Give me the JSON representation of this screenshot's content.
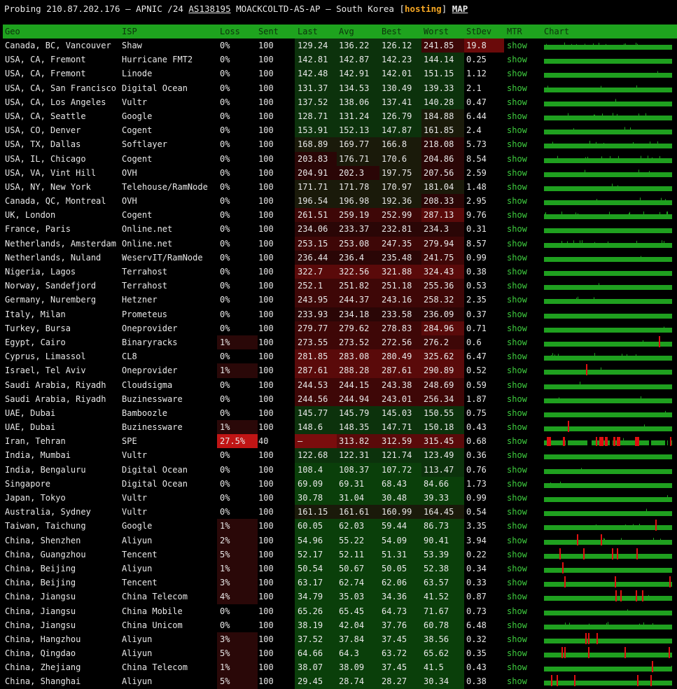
{
  "header": {
    "prefix": "Probing 210.87.202.176 – APNIC /24",
    "asn": "AS138195",
    "org": "MOACKCOLTD-AS-AP – South Korea",
    "bracket_open": "[",
    "tag": "hosting",
    "bracket_close": "]",
    "map_link": "MAP"
  },
  "columns": [
    "Geo",
    "ISP",
    "Loss",
    "Sent",
    "Last",
    "Avg",
    "Best",
    "Worst",
    "StDev",
    "MTR",
    "Chart"
  ],
  "mtr_label": "show",
  "colors": {
    "header_green": "#1ea31e",
    "good_green": "#0c4a0c",
    "bad_red": "#8a1010",
    "link_green": "#3fce3f",
    "accent_orange": "#f5a623"
  },
  "rows": [
    {
      "geo": "Canada, BC, Vancouver",
      "isp": "Shaw",
      "loss": "0%",
      "sent": "100",
      "last": "129.24",
      "avg": "136.22",
      "best": "126.12",
      "worst": "241.85",
      "stdev": "19.8"
    },
    {
      "geo": "USA, CA, Fremont",
      "isp": "Hurricane FMT2",
      "loss": "0%",
      "sent": "100",
      "last": "142.81",
      "avg": "142.87",
      "best": "142.23",
      "worst": "144.14",
      "stdev": "0.25"
    },
    {
      "geo": "USA, CA, Fremont",
      "isp": "Linode",
      "loss": "0%",
      "sent": "100",
      "last": "142.48",
      "avg": "142.91",
      "best": "142.01",
      "worst": "151.15",
      "stdev": "1.12"
    },
    {
      "geo": "USA, CA, San Francisco",
      "isp": "Digital Ocean",
      "loss": "0%",
      "sent": "100",
      "last": "131.37",
      "avg": "134.53",
      "best": "130.49",
      "worst": "139.33",
      "stdev": "2.1"
    },
    {
      "geo": "USA, CA, Los Angeles",
      "isp": "Vultr",
      "loss": "0%",
      "sent": "100",
      "last": "137.52",
      "avg": "138.06",
      "best": "137.41",
      "worst": "140.28",
      "stdev": "0.47"
    },
    {
      "geo": "USA, CA, Seattle",
      "isp": "Google",
      "loss": "0%",
      "sent": "100",
      "last": "128.71",
      "avg": "131.24",
      "best": "126.79",
      "worst": "184.88",
      "stdev": "6.44"
    },
    {
      "geo": "USA, CO, Denver",
      "isp": "Cogent",
      "loss": "0%",
      "sent": "100",
      "last": "153.91",
      "avg": "152.13",
      "best": "147.87",
      "worst": "161.85",
      "stdev": "2.4"
    },
    {
      "geo": "USA, TX, Dallas",
      "isp": "Softlayer",
      "loss": "0%",
      "sent": "100",
      "last": "168.89",
      "avg": "169.77",
      "best": "166.8",
      "worst": "218.08",
      "stdev": "5.73"
    },
    {
      "geo": "USA, IL, Chicago",
      "isp": "Cogent",
      "loss": "0%",
      "sent": "100",
      "last": "203.83",
      "avg": "176.71",
      "best": "170.6",
      "worst": "204.86",
      "stdev": "8.54"
    },
    {
      "geo": "USA, VA, Vint Hill",
      "isp": "OVH",
      "loss": "0%",
      "sent": "100",
      "last": "204.91",
      "avg": "202.3",
      "best": "197.75",
      "worst": "207.56",
      "stdev": "2.59"
    },
    {
      "geo": "USA, NY, New York",
      "isp": "Telehouse/RamNode",
      "loss": "0%",
      "sent": "100",
      "last": "171.71",
      "avg": "171.78",
      "best": "170.97",
      "worst": "181.04",
      "stdev": "1.48"
    },
    {
      "geo": "Canada, QC, Montreal",
      "isp": "OVH",
      "loss": "0%",
      "sent": "100",
      "last": "196.54",
      "avg": "196.98",
      "best": "192.36",
      "worst": "208.33",
      "stdev": "2.95"
    },
    {
      "geo": "UK, London",
      "isp": "Cogent",
      "loss": "0%",
      "sent": "100",
      "last": "261.51",
      "avg": "259.19",
      "best": "252.99",
      "worst": "287.13",
      "stdev": "9.76"
    },
    {
      "geo": "France, Paris",
      "isp": "Online.net",
      "loss": "0%",
      "sent": "100",
      "last": "234.06",
      "avg": "233.37",
      "best": "232.81",
      "worst": "234.3",
      "stdev": "0.31"
    },
    {
      "geo": "Netherlands, Amsterdam",
      "isp": "Online.net",
      "loss": "0%",
      "sent": "100",
      "last": "253.15",
      "avg": "253.08",
      "best": "247.35",
      "worst": "279.94",
      "stdev": "8.57"
    },
    {
      "geo": "Netherlands, Nuland",
      "isp": "WeservIT/RamNode",
      "loss": "0%",
      "sent": "100",
      "last": "236.44",
      "avg": "236.4",
      "best": "235.48",
      "worst": "241.75",
      "stdev": "0.99"
    },
    {
      "geo": "Nigeria, Lagos",
      "isp": "Terrahost",
      "loss": "0%",
      "sent": "100",
      "last": "322.7",
      "avg": "322.56",
      "best": "321.88",
      "worst": "324.43",
      "stdev": "0.38"
    },
    {
      "geo": "Norway, Sandefjord",
      "isp": "Terrahost",
      "loss": "0%",
      "sent": "100",
      "last": "252.1",
      "avg": "251.82",
      "best": "251.18",
      "worst": "255.36",
      "stdev": "0.53"
    },
    {
      "geo": "Germany, Nuremberg",
      "isp": "Hetzner",
      "loss": "0%",
      "sent": "100",
      "last": "243.95",
      "avg": "244.37",
      "best": "243.16",
      "worst": "258.32",
      "stdev": "2.35"
    },
    {
      "geo": "Italy, Milan",
      "isp": "Prometeus",
      "loss": "0%",
      "sent": "100",
      "last": "233.93",
      "avg": "234.18",
      "best": "233.58",
      "worst": "236.09",
      "stdev": "0.37"
    },
    {
      "geo": "Turkey, Bursa",
      "isp": "Oneprovider",
      "loss": "0%",
      "sent": "100",
      "last": "279.77",
      "avg": "279.62",
      "best": "278.83",
      "worst": "284.96",
      "stdev": "0.71"
    },
    {
      "geo": "Egypt, Cairo",
      "isp": "Binaryracks",
      "loss": "1%",
      "sent": "100",
      "last": "273.55",
      "avg": "273.52",
      "best": "272.56",
      "worst": "276.2",
      "stdev": "0.6"
    },
    {
      "geo": "Cyprus, Limassol",
      "isp": "CL8",
      "loss": "0%",
      "sent": "100",
      "last": "281.85",
      "avg": "283.08",
      "best": "280.49",
      "worst": "325.62",
      "stdev": "6.47"
    },
    {
      "geo": "Israel, Tel Aviv",
      "isp": "Oneprovider",
      "loss": "1%",
      "sent": "100",
      "last": "287.61",
      "avg": "288.28",
      "best": "287.61",
      "worst": "290.89",
      "stdev": "0.52"
    },
    {
      "geo": "Saudi Arabia, Riyadh",
      "isp": "Cloudsigma",
      "loss": "0%",
      "sent": "100",
      "last": "244.53",
      "avg": "244.15",
      "best": "243.38",
      "worst": "248.69",
      "stdev": "0.59"
    },
    {
      "geo": "Saudi Arabia, Riyadh",
      "isp": "Buzinessware",
      "loss": "0%",
      "sent": "100",
      "last": "244.56",
      "avg": "244.94",
      "best": "243.01",
      "worst": "256.34",
      "stdev": "1.87"
    },
    {
      "geo": "UAE, Dubai",
      "isp": "Bamboozle",
      "loss": "0%",
      "sent": "100",
      "last": "145.77",
      "avg": "145.79",
      "best": "145.03",
      "worst": "150.55",
      "stdev": "0.75"
    },
    {
      "geo": "UAE, Dubai",
      "isp": "Buzinessware",
      "loss": "1%",
      "sent": "100",
      "last": "148.6",
      "avg": "148.35",
      "best": "147.71",
      "worst": "150.18",
      "stdev": "0.43"
    },
    {
      "geo": "Iran, Tehran",
      "isp": "SPE",
      "loss": "27.5%",
      "sent": "40",
      "last": "–",
      "avg": "313.82",
      "best": "312.59",
      "worst": "315.45",
      "stdev": "0.68"
    },
    {
      "geo": "India, Mumbai",
      "isp": "Vultr",
      "loss": "0%",
      "sent": "100",
      "last": "122.68",
      "avg": "122.31",
      "best": "121.74",
      "worst": "123.49",
      "stdev": "0.36"
    },
    {
      "geo": "India, Bengaluru",
      "isp": "Digital Ocean",
      "loss": "0%",
      "sent": "100",
      "last": "108.4",
      "avg": "108.37",
      "best": "107.72",
      "worst": "113.47",
      "stdev": "0.76"
    },
    {
      "geo": "Singapore",
      "isp": "Digital Ocean",
      "loss": "0%",
      "sent": "100",
      "last": "69.09",
      "avg": "69.31",
      "best": "68.43",
      "worst": "84.66",
      "stdev": "1.73"
    },
    {
      "geo": "Japan, Tokyo",
      "isp": "Vultr",
      "loss": "0%",
      "sent": "100",
      "last": "30.78",
      "avg": "31.04",
      "best": "30.48",
      "worst": "39.33",
      "stdev": "0.99"
    },
    {
      "geo": "Australia, Sydney",
      "isp": "Vultr",
      "loss": "0%",
      "sent": "100",
      "last": "161.15",
      "avg": "161.61",
      "best": "160.99",
      "worst": "164.45",
      "stdev": "0.54"
    },
    {
      "geo": "Taiwan, Taichung",
      "isp": "Google",
      "loss": "1%",
      "sent": "100",
      "last": "60.05",
      "avg": "62.03",
      "best": "59.44",
      "worst": "86.73",
      "stdev": "3.35"
    },
    {
      "geo": "China, Shenzhen",
      "isp": "Aliyun",
      "loss": "2%",
      "sent": "100",
      "last": "54.96",
      "avg": "55.22",
      "best": "54.09",
      "worst": "90.41",
      "stdev": "3.94"
    },
    {
      "geo": "China, Guangzhou",
      "isp": "Tencent",
      "loss": "5%",
      "sent": "100",
      "last": "52.17",
      "avg": "52.11",
      "best": "51.31",
      "worst": "53.39",
      "stdev": "0.22"
    },
    {
      "geo": "China, Beijing",
      "isp": "Aliyun",
      "loss": "1%",
      "sent": "100",
      "last": "50.54",
      "avg": "50.67",
      "best": "50.05",
      "worst": "52.38",
      "stdev": "0.34"
    },
    {
      "geo": "China, Beijing",
      "isp": "Tencent",
      "loss": "3%",
      "sent": "100",
      "last": "63.17",
      "avg": "62.74",
      "best": "62.06",
      "worst": "63.57",
      "stdev": "0.33"
    },
    {
      "geo": "China, Jiangsu",
      "isp": "China Telecom",
      "loss": "4%",
      "sent": "100",
      "last": "34.79",
      "avg": "35.03",
      "best": "34.36",
      "worst": "41.52",
      "stdev": "0.87"
    },
    {
      "geo": "China, Jiangsu",
      "isp": "China Mobile",
      "loss": "0%",
      "sent": "100",
      "last": "65.26",
      "avg": "65.45",
      "best": "64.73",
      "worst": "71.67",
      "stdev": "0.73"
    },
    {
      "geo": "China, Jiangsu",
      "isp": "China Unicom",
      "loss": "0%",
      "sent": "100",
      "last": "38.19",
      "avg": "42.04",
      "best": "37.76",
      "worst": "60.78",
      "stdev": "6.48"
    },
    {
      "geo": "China, Hangzhou",
      "isp": "Aliyun",
      "loss": "3%",
      "sent": "100",
      "last": "37.52",
      "avg": "37.84",
      "best": "37.45",
      "worst": "38.56",
      "stdev": "0.32"
    },
    {
      "geo": "China, Qingdao",
      "isp": "Aliyun",
      "loss": "5%",
      "sent": "100",
      "last": "64.66",
      "avg": "64.3",
      "best": "63.72",
      "worst": "65.62",
      "stdev": "0.35"
    },
    {
      "geo": "China, Zhejiang",
      "isp": "China Telecom",
      "loss": "1%",
      "sent": "100",
      "last": "38.07",
      "avg": "38.09",
      "best": "37.45",
      "worst": "41.5",
      "stdev": "0.43"
    },
    {
      "geo": "China, Shanghai",
      "isp": "Aliyun",
      "loss": "5%",
      "sent": "100",
      "last": "29.45",
      "avg": "28.74",
      "best": "28.27",
      "worst": "30.34",
      "stdev": "0.38"
    }
  ]
}
